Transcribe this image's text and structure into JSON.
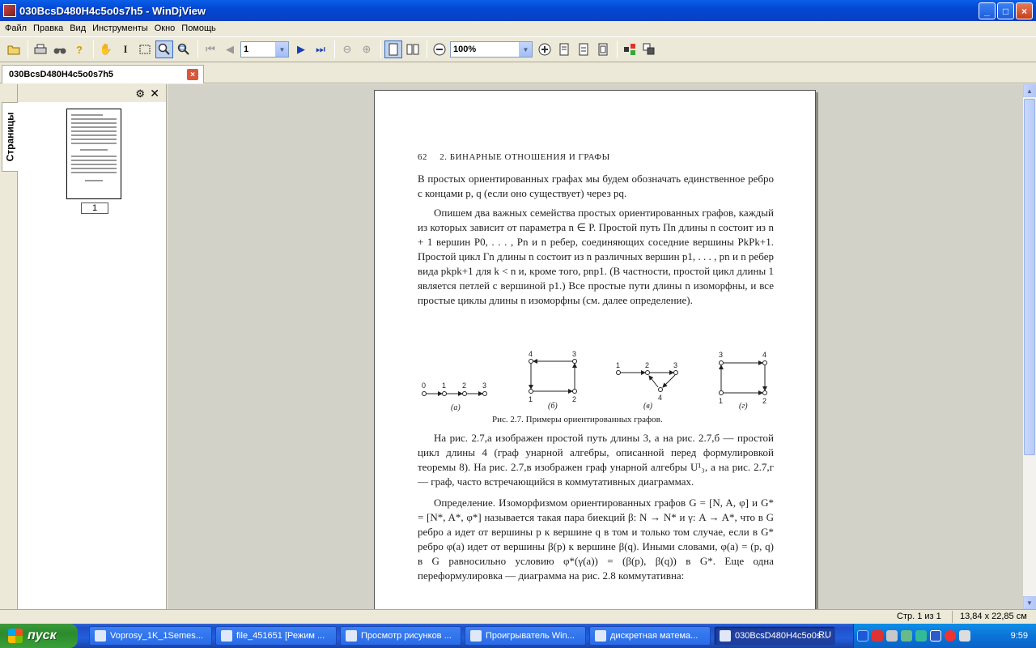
{
  "window": {
    "title": "030BcsD480H4c5o0s7h5 - WinDjView",
    "minimize": "_",
    "maximize": "□",
    "close": "×"
  },
  "menu": [
    "Файл",
    "Правка",
    "Вид",
    "Инструменты",
    "Окно",
    "Помощь"
  ],
  "toolbar": {
    "page_value": "1",
    "zoom_value": "100%"
  },
  "tab": {
    "label": "030BcsD480H4c5o0s7h5",
    "close": "×"
  },
  "sidebar": {
    "tab_label": "Страницы",
    "thumbnail_page": "1"
  },
  "page": {
    "number": "62",
    "header": "2. БИНАРНЫЕ ОТНОШЕНИЯ И ГРАФЫ",
    "p1": "В простых ориентированных графах мы будем обозначать единственное ребро с концами p, q (если оно существует) через pq.",
    "p2": "Опишем два важных семейства простых ориентированных графов, каждый из которых зависит от параметра n ∈ P. Простой путь Πn длины n состоит из n + 1 вершин P0, . . . , Pn и n ребер, соединяющих соседние вершины PkPk+1. Простой цикл Γn длины n состоит из n различных вершин p1, . . . , pn и n ребер вида pkpk+1 для k < n и, кроме того, pnp1. (В частности, простой цикл длины 1 является петлей с вершиной p1.) Все простые пути длины n изоморфны, и все простые циклы длины n изоморфны (см. далее определение).",
    "fig_labels": [
      "(а)",
      "(б)",
      "(в)",
      "(г)"
    ],
    "caption": "Рис. 2.7. Примеры ориентированных графов.",
    "p3": "На рис. 2.7,а изображен простой путь длины 3, а на рис. 2.7,б — простой цикл длины 4 (граф унарной алгебры, описанной перед формулировкой теоремы 8). На рис. 2.7,в изображен граф унарной алгебры U¹₃, а на рис. 2.7,г — граф, часто встречающийся в коммутативных диаграммах.",
    "p4": "Определение. Изоморфизмом ориентированных графов G = [N, A, φ] и G* = [N*, A*, φ*] называется такая пара биекций β: N → N* и γ: A → A*, что в G ребро a идет от вершины p к вершине q в том и только том случае, если в G* ребро φ(a) идет от вершины β(p) к вершине β(q). Иными словами, φ(a) = (p, q) в G равносильно условию φ*(γ(a)) = (β(p), β(q)) в G*. Еще одна переформулировка — диаграмма на рис. 2.8 коммутативна:"
  },
  "status": {
    "page": "Стр. 1 из 1",
    "size": "13,84 x 22,85 см"
  },
  "taskbar": {
    "start": "пуск",
    "tasks": [
      "Voprosy_1K_1Semes...",
      "file_451651 [Режим ...",
      "Просмотр рисунков ...",
      "Проигрыватель Win...",
      "дискретная матема...",
      "030BcsD480H4c5o0s..."
    ],
    "lang": "RU",
    "clock": "9:59"
  }
}
